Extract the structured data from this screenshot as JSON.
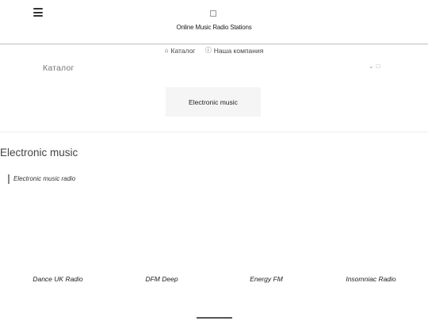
{
  "header": {
    "menu_icon": "hamburger-icon",
    "logo_icon": "broken-image-icon",
    "site_title": "Online Music Radio Stations"
  },
  "topnav": {
    "items": [
      {
        "icon": "home-icon",
        "label": "Каталог"
      },
      {
        "icon": "info-icon",
        "label": "Наша компания"
      }
    ]
  },
  "catalog": {
    "label": "Каталог",
    "icons": [
      "chevron-down-icon",
      "trash-icon"
    ]
  },
  "category_button": {
    "label": "Electronic music"
  },
  "page_title": "Electronic music",
  "subcategory": "Electronic music radio",
  "stations": [
    "Dance UK Radio",
    "DFM Deep",
    "Energy FM",
    "Insomniac Radio"
  ]
}
